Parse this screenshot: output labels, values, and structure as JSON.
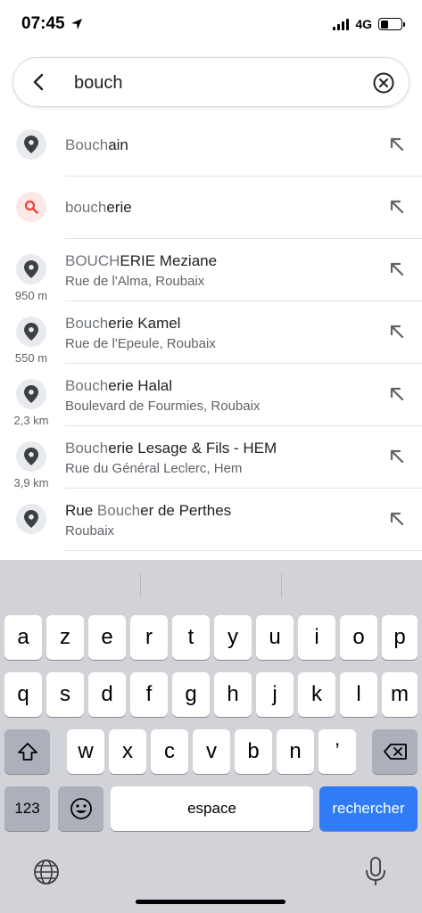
{
  "status_bar": {
    "time": "07:45",
    "network": "4G"
  },
  "search": {
    "query": "bouch"
  },
  "results": [
    {
      "icon": "pin-icon",
      "match": "Bouch",
      "rest": "ain",
      "sub": "",
      "distance": ""
    },
    {
      "icon": "search-icon",
      "match": "bouch",
      "rest": "erie",
      "sub": "",
      "distance": ""
    },
    {
      "icon": "pin-icon",
      "match": "BOUCH",
      "rest": "ERIE Meziane",
      "sub": "Rue de l'Alma, Roubaix",
      "distance": "950 m"
    },
    {
      "icon": "pin-icon",
      "match": "Bouch",
      "rest": "erie Kamel",
      "sub": "Rue de l'Epeule, Roubaix",
      "distance": "550 m"
    },
    {
      "icon": "pin-icon",
      "match": "Bouch",
      "rest": "erie Halal",
      "sub": "Boulevard de Fourmies, Roubaix",
      "distance": "2,3 km"
    },
    {
      "icon": "pin-icon",
      "match": "Bouch",
      "rest": "erie Lesage & Fils - HEM",
      "sub": "Rue du Général Leclerc, Hem",
      "distance": "3,9 km"
    },
    {
      "icon": "pin-icon",
      "prefix": "Rue ",
      "match": "Bouch",
      "rest": "er de Perthes",
      "sub": "Roubaix",
      "distance": ""
    }
  ],
  "keyboard": {
    "row1": [
      "a",
      "z",
      "e",
      "r",
      "t",
      "y",
      "u",
      "i",
      "o",
      "p"
    ],
    "row2": [
      "q",
      "s",
      "d",
      "f",
      "g",
      "h",
      "j",
      "k",
      "l",
      "m"
    ],
    "row3": [
      "w",
      "x",
      "c",
      "v",
      "b",
      "n",
      "’"
    ],
    "numbers_label": "123",
    "space_label": "espace",
    "return_label": "rechercher"
  },
  "colors": {
    "accent": "#2f7cf6",
    "search_icon": "#ea4335",
    "pin": "#3c4043"
  }
}
